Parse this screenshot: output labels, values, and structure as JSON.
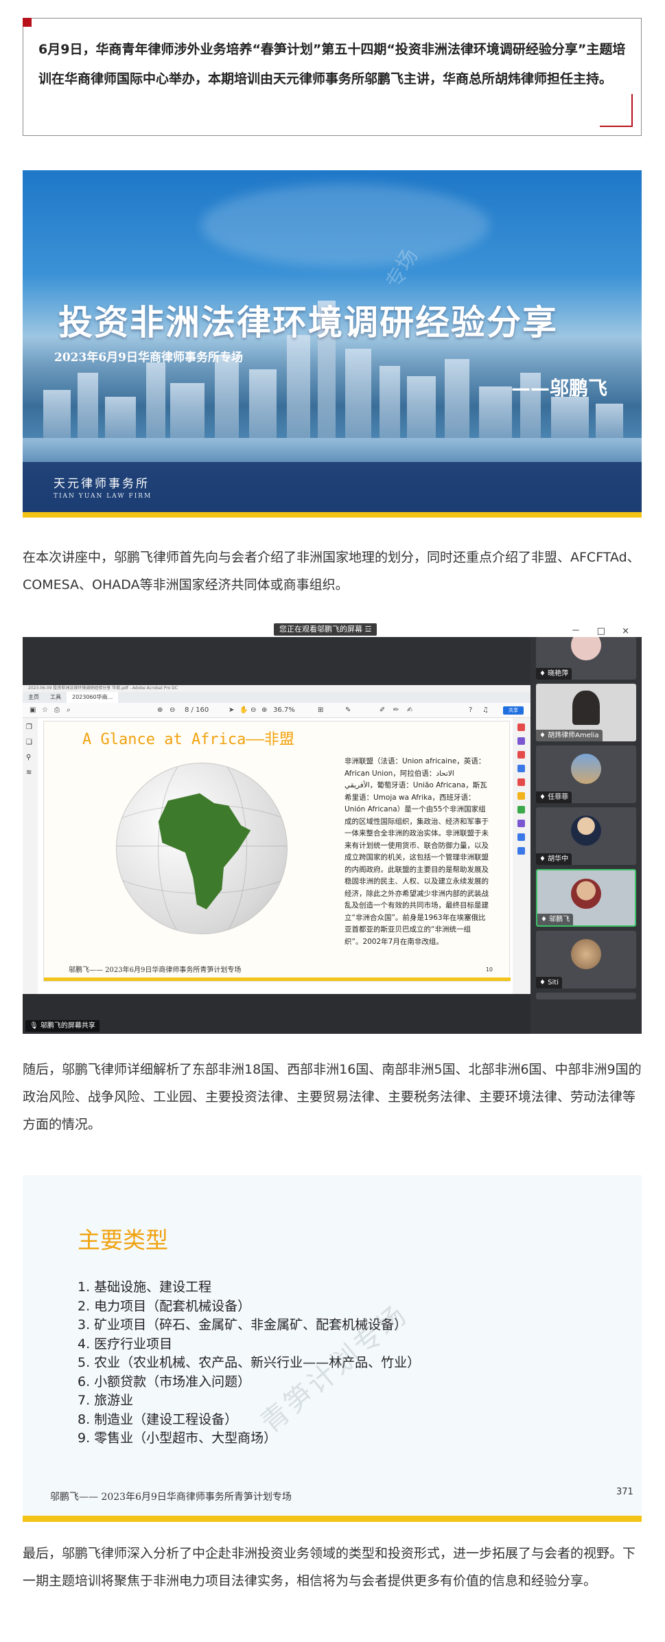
{
  "intro": {
    "text": "6月9日，华商青年律师涉外业务培养“春笋计划”第五十四期“投资非洲法律环境调研经验分享”主题培训在华商律师国际中心举办，本期培训由天元律师事务所邬鹏飞主讲，华商总所胡炜律师担任主持。"
  },
  "banner": {
    "title": "投资非洲法律环境调研经验分享",
    "subtitle": "2023年6月9日华商律师事务所专场",
    "speaker": "——邬鹏飞",
    "watermark": "专场",
    "firm_cn": "天元律师事务所",
    "firm_en": "TIAN YUAN LAW FIRM"
  },
  "para1": "在本次讲座中，邬鹏飞律师首先向与会者介绍了非洲国家地理的划分，同时还重点介绍了非盟、AFCFTAd、COMESA、OHADA等非洲国家经济共同体或商事组织。",
  "meeting": {
    "banner_text": "您正在观看邬鹏飞的屏幕",
    "window_controls": "－ □ ×",
    "menu_text": "2023.06.09 投资非洲法律环境调研经验分享 华商.pdf - Adobe Acrobat Pro DC",
    "tabs": [
      "主页",
      "工具",
      "2023060华商..."
    ],
    "page_indicator": "8 / 160",
    "zoom": "36.7%",
    "share_button": "共享",
    "share_label": "邬鹏飞的屏幕共享",
    "slide": {
      "heading": "A Glance at Africa——非盟",
      "body": "非洲联盟（法语：Union africaine，英语：African Union，阿拉伯语：الاتحاد الأفريقي，葡萄牙语：União Africana，斯瓦希里语：Umoja wa Afrika，西班牙语：Unión Africana）是一个由55个非洲国家组成的区域性国际组织，集政治、经济和军事于一体来整合全非洲的政治实体。非洲联盟于未来有计划统一使用货币、联合防御力量，以及成立跨国家的机关，这包括一个管理非洲联盟的内阁政府。此联盟的主要目的是帮助发展及稳固非洲的民主、人权、以及建立永续发展的经济，除此之外亦希望减少非洲内部的武装战乱及创造一个有效的共同市场，最终目标是建立“非洲合众国”。前身是1963年在埃塞俄比亚首都亚的斯亚贝巴成立的“非洲统一组织”。2002年7月在南非改组。",
      "footer": "邬鹏飞—— 2023年6月9日华商律师事务所青笋计划专场",
      "page_num": "10"
    },
    "participants": [
      {
        "name": "晓艳萍"
      },
      {
        "name": "胡炜律师Amelia"
      },
      {
        "name": "任菲菲"
      },
      {
        "name": "胡华中"
      },
      {
        "name": "邬鹏飞"
      },
      {
        "name": "Siti"
      }
    ]
  },
  "para2": "随后，邬鹏飞律师详细解析了东部非洲18国、西部非洲16国、南部非洲5国、北部非洲6国、中部非洲9国的政治风险、战争风险、工业园、主要投资法律、主要贸易法律、主要税务法律、主要环境法律、劳动法律等方面的情况。",
  "types": {
    "title": "主要类型",
    "items": [
      "1. 基础设施、建设工程",
      "2. 电力项目（配套机械设备）",
      "3. 矿业项目（碎石、金属矿、非金属矿、配套机械设备）",
      "4. 医疗行业项目",
      "5. 农业（农业机械、农产品、新兴行业——林产品、竹业）",
      "6. 小额贷款（市场准入问题）",
      "7. 旅游业",
      "8. 制造业（建设工程设备）",
      "9. 零售业（小型超市、大型商场）"
    ],
    "watermark": "青笋计划专场",
    "footer": "邬鹏飞—— 2023年6月9日华商律师事务所青笋计划专场",
    "page_num": "371"
  },
  "para3": "最后，邬鹏飞律师深入分析了中企赴非洲投资业务领域的类型和投资形式，进一步拓展了与会者的视野。下一期主题培训将聚焦于非洲电力项目法律实务，相信将为与会者提供更多有价值的信息和经验分享。",
  "colors": {
    "accent_red": "#b8111a",
    "slide_yellow": "#f3c316",
    "heading_orange": "#f0a20f",
    "active_green": "#3cc36a"
  }
}
